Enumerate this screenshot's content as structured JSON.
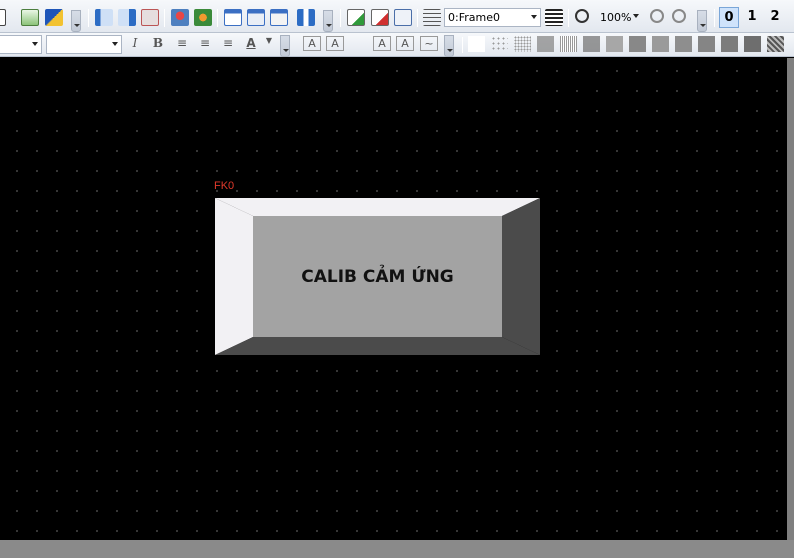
{
  "toolbar": {
    "frame_select": {
      "value": "0:Frame0"
    },
    "zoom": {
      "value": "100%"
    },
    "language_buttons": [
      "0",
      "1",
      "2"
    ],
    "active_language": "0"
  },
  "format_bar": {
    "font_select": {
      "value": ""
    },
    "size_select": {
      "value": ""
    },
    "italic_label": "I",
    "bold_label": "B",
    "font_color_label": "A"
  },
  "canvas": {
    "object_id": "FK0",
    "button": {
      "label": "CALIB CẢM ỨNG",
      "colors": {
        "face": "#a3a3a3",
        "highlight": "#f2f1f4",
        "shadow": "#4b4b4b",
        "label_id": "#e0392b"
      }
    }
  }
}
